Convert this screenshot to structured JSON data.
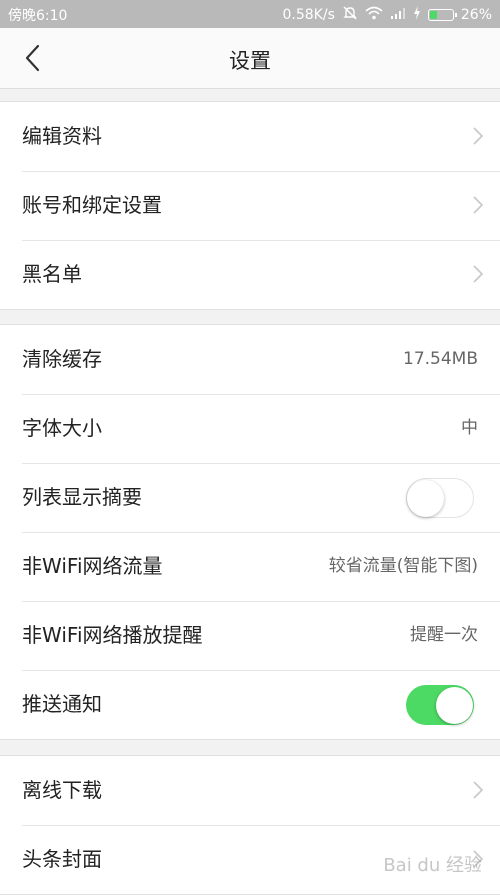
{
  "status_bar": {
    "time": "傍晚6:10",
    "network_speed": "0.58K/s",
    "battery_percent": "26%",
    "icons": [
      "mute-icon",
      "wifi-icon",
      "signal-icon",
      "charging-icon",
      "battery-icon"
    ]
  },
  "nav": {
    "title": "设置",
    "back_icon": "chevron-left-icon"
  },
  "group1": [
    {
      "label": "编辑资料"
    },
    {
      "label": "账号和绑定设置"
    },
    {
      "label": "黑名单"
    }
  ],
  "group2": [
    {
      "label": "清除缓存",
      "value": "17.54MB"
    },
    {
      "label": "字体大小",
      "value": "中"
    },
    {
      "label": "列表显示摘要",
      "toggle": false
    },
    {
      "label": "非WiFi网络流量",
      "value": "较省流量(智能下图)"
    },
    {
      "label": "非WiFi网络播放提醒",
      "value": "提醒一次"
    },
    {
      "label": "推送通知",
      "toggle": true
    }
  ],
  "group3": [
    {
      "label": "离线下载"
    },
    {
      "label": "头条封面"
    }
  ],
  "watermark": "Bai du 经验",
  "colors": {
    "toggle_on": "#4cd964",
    "status_bar": "#b9b9b9"
  }
}
